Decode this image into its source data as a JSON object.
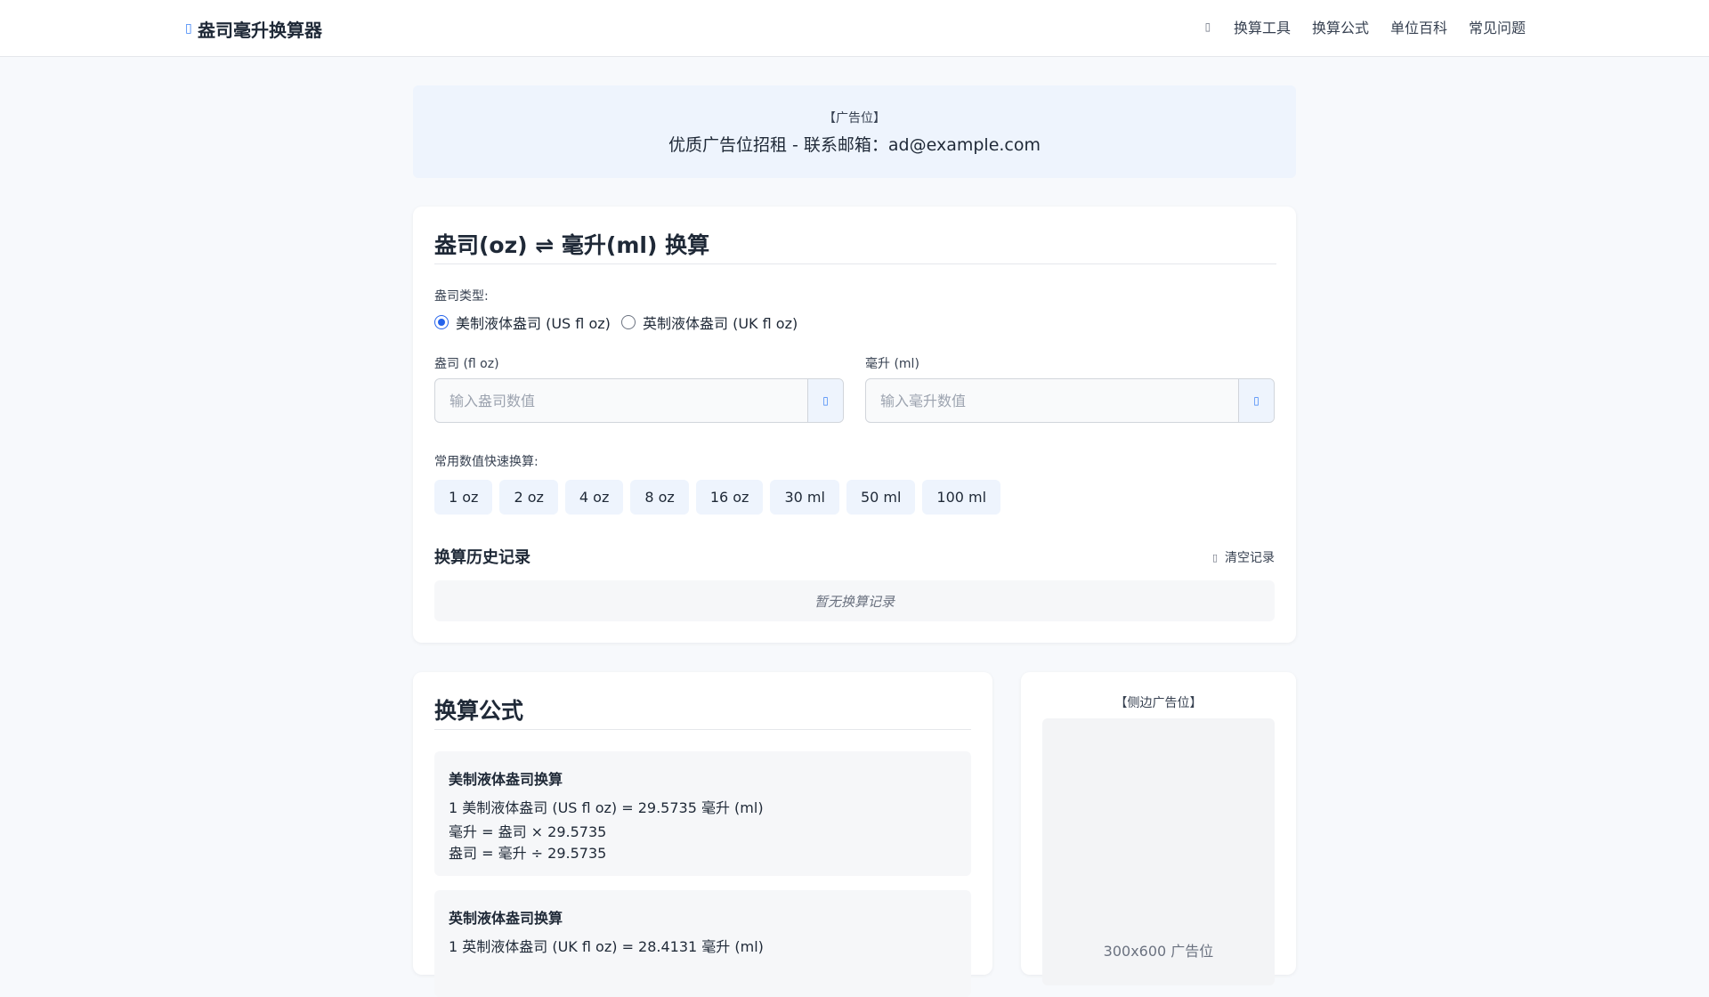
{
  "header": {
    "logo_icon": "liquid-drop-icon",
    "title": "盎司毫升换算器",
    "nav": [
      "换算工具",
      "换算公式",
      "单位百科",
      "常见问题"
    ],
    "language_icon": "globe-icon"
  },
  "ad_banner": {
    "label": "【广告位】",
    "text": "优质广告位招租 - 联系邮箱：ad@example.com"
  },
  "converter": {
    "title": "盎司(oz) ⇌ 毫升(ml) 换算",
    "type_label": "盎司类型:",
    "options": [
      "美制液体盎司 (US fl oz)",
      "英制液体盎司 (UK fl oz)"
    ],
    "selected_option": "美制液体盎司 (US fl oz)",
    "oz_label": "盎司 (fl oz)",
    "oz_placeholder": "输入盎司数值",
    "oz_value": "",
    "ml_label": "毫升 (ml)",
    "ml_placeholder": "输入毫升数值",
    "ml_value": "",
    "quick_label": "常用数值快速换算:",
    "quick_values": [
      "1 oz",
      "2 oz",
      "4 oz",
      "8 oz",
      "16 oz",
      "30 ml",
      "50 ml",
      "100 ml"
    ],
    "history_title": "换算历史记录",
    "clear_label": "清空记录",
    "history_empty": "暂无换算记录"
  },
  "formula": {
    "title": "换算公式",
    "us_title": "美制液体盎司换算",
    "us_lines": [
      "1 美制液体盎司 (US fl oz) = 29.5735 毫升 (ml)",
      "毫升 = 盎司 × 29.5735",
      "盎司 = 毫升 ÷ 29.5735"
    ],
    "uk_title": "英制液体盎司换算",
    "uk_lines": [
      "1 英制液体盎司 (UK fl oz) = 28.4131 毫升 (ml)"
    ]
  },
  "side_ad": {
    "label": "【侧边广告位】",
    "slot_text": "300x600 广告位"
  },
  "colors": {
    "accent": "#2563eb",
    "chip_bg": "#eef4fd",
    "page_bg": "#f7f9fc"
  }
}
